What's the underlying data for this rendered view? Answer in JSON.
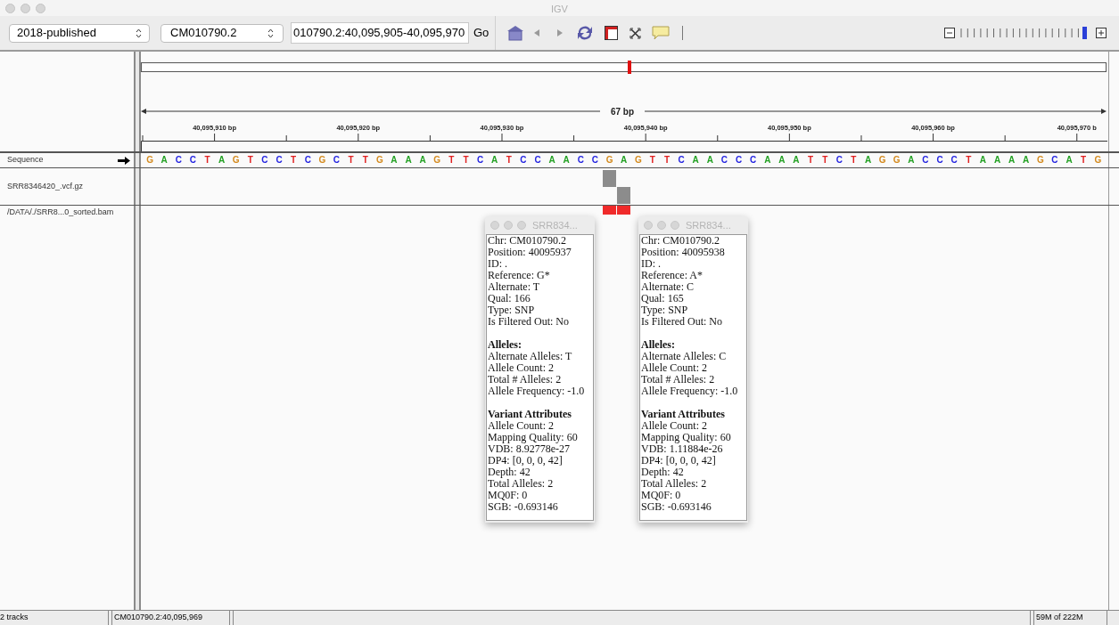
{
  "window": {
    "title": "IGV"
  },
  "toolbar": {
    "genome": "2018-published",
    "chromosome": "CM010790.2",
    "locus": "010790.2:40,095,905-40,095,970",
    "go": "Go",
    "zoom": {
      "level": 0.96
    }
  },
  "ruler": {
    "span": "67 bp",
    "ticks": [
      "40,095,910 bp",
      "40,095,920 bp",
      "40,095,930 bp",
      "40,095,940 bp",
      "40,095,950 bp",
      "40,095,960 bp",
      "40,095,970 b"
    ]
  },
  "tracks": [
    {
      "name": "Sequence",
      "kind": "sequence"
    },
    {
      "name": "SRR8346420_.vcf.gz",
      "kind": "variants"
    },
    {
      "name": "/DATA/./SRR8...0_sorted.bam",
      "kind": "alignments"
    }
  ],
  "bases": [
    {
      "b": "G",
      "color": "#d48a1e"
    },
    {
      "b": "A",
      "color": "#22a022"
    },
    {
      "b": "C",
      "color": "#2424e0"
    },
    {
      "b": "C",
      "color": "#2424e0"
    },
    {
      "b": "T",
      "color": "#e02020"
    },
    {
      "b": "A",
      "color": "#22a022"
    },
    {
      "b": "G",
      "color": "#d48a1e"
    },
    {
      "b": "T",
      "color": "#e02020"
    },
    {
      "b": "C",
      "color": "#2424e0"
    },
    {
      "b": "C",
      "color": "#2424e0"
    },
    {
      "b": "T",
      "color": "#e02020"
    },
    {
      "b": "C",
      "color": "#2424e0"
    },
    {
      "b": "G",
      "color": "#d48a1e"
    },
    {
      "b": "C",
      "color": "#2424e0"
    },
    {
      "b": "T",
      "color": "#e02020"
    },
    {
      "b": "T",
      "color": "#e02020"
    },
    {
      "b": "G",
      "color": "#d48a1e"
    },
    {
      "b": "A",
      "color": "#22a022"
    },
    {
      "b": "A",
      "color": "#22a022"
    },
    {
      "b": "A",
      "color": "#22a022"
    },
    {
      "b": "G",
      "color": "#d48a1e"
    },
    {
      "b": "T",
      "color": "#e02020"
    },
    {
      "b": "T",
      "color": "#e02020"
    },
    {
      "b": "C",
      "color": "#2424e0"
    },
    {
      "b": "A",
      "color": "#22a022"
    },
    {
      "b": "T",
      "color": "#e02020"
    },
    {
      "b": "C",
      "color": "#2424e0"
    },
    {
      "b": "C",
      "color": "#2424e0"
    },
    {
      "b": "A",
      "color": "#22a022"
    },
    {
      "b": "A",
      "color": "#22a022"
    },
    {
      "b": "C",
      "color": "#2424e0"
    },
    {
      "b": "C",
      "color": "#2424e0"
    },
    {
      "b": "G",
      "color": "#d48a1e",
      "kind": "upper"
    },
    {
      "b": "A",
      "color": "#22a022",
      "kind": "lower"
    },
    {
      "b": "G",
      "color": "#d48a1e"
    },
    {
      "b": "T",
      "color": "#e02020"
    },
    {
      "b": "T",
      "color": "#e02020"
    },
    {
      "b": "C",
      "color": "#2424e0"
    },
    {
      "b": "A",
      "color": "#22a022"
    },
    {
      "b": "A",
      "color": "#22a022"
    },
    {
      "b": "C",
      "color": "#2424e0"
    },
    {
      "b": "C",
      "color": "#2424e0"
    },
    {
      "b": "C",
      "color": "#2424e0"
    },
    {
      "b": "A",
      "color": "#22a022"
    },
    {
      "b": "A",
      "color": "#22a022"
    },
    {
      "b": "A",
      "color": "#22a022"
    },
    {
      "b": "T",
      "color": "#e02020"
    },
    {
      "b": "T",
      "color": "#e02020"
    },
    {
      "b": "C",
      "color": "#2424e0"
    },
    {
      "b": "T",
      "color": "#e02020"
    },
    {
      "b": "A",
      "color": "#22a022"
    },
    {
      "b": "G",
      "color": "#d48a1e"
    },
    {
      "b": "G",
      "color": "#d48a1e"
    },
    {
      "b": "A",
      "color": "#22a022"
    },
    {
      "b": "C",
      "color": "#2424e0"
    },
    {
      "b": "C",
      "color": "#2424e0"
    },
    {
      "b": "C",
      "color": "#2424e0"
    },
    {
      "b": "T",
      "color": "#e02020"
    },
    {
      "b": "A",
      "color": "#22a022"
    },
    {
      "b": "A",
      "color": "#22a022"
    },
    {
      "b": "A",
      "color": "#22a022"
    },
    {
      "b": "A",
      "color": "#22a022"
    },
    {
      "b": "G",
      "color": "#d48a1e"
    },
    {
      "b": "C",
      "color": "#2424e0"
    },
    {
      "b": "A",
      "color": "#22a022"
    },
    {
      "b": "T",
      "color": "#e02020"
    },
    {
      "b": "G",
      "color": "#d48a1e"
    }
  ],
  "popups": [
    {
      "title": "SRR834...",
      "sections": [
        {
          "lines": [
            "Chr: CM010790.2",
            "Position: 40095937",
            "ID: .",
            "Reference: G*",
            "Alternate: T",
            "Qual: 166",
            "Type: SNP",
            "Is Filtered Out: No"
          ]
        },
        {
          "heading": "Alleles:",
          "lines": [
            "Alternate Alleles: T",
            "Allele Count: 2",
            "Total # Alleles: 2",
            "Allele Frequency: -1.0"
          ]
        },
        {
          "heading": "Variant Attributes",
          "lines": [
            "Allele Count: 2",
            "Mapping Quality: 60",
            "VDB: 8.92778e-27",
            "DP4: [0, 0, 0, 42]",
            "Depth: 42",
            "Total Alleles: 2",
            "MQ0F: 0",
            "SGB: -0.693146"
          ]
        }
      ]
    },
    {
      "title": "SRR834...",
      "sections": [
        {
          "lines": [
            "Chr: CM010790.2",
            "Position: 40095938",
            "ID: .",
            "Reference: A*",
            "Alternate: C",
            "Qual: 165",
            "Type: SNP",
            "Is Filtered Out: No"
          ]
        },
        {
          "heading": "Alleles:",
          "lines": [
            "Alternate Alleles: C",
            "Allele Count: 2",
            "Total # Alleles: 2",
            "Allele Frequency: -1.0"
          ]
        },
        {
          "heading": "Variant Attributes",
          "lines": [
            "Allele Count: 2",
            "Mapping Quality: 60",
            "VDB: 1.11884e-26",
            "DP4: [0, 0, 0, 42]",
            "Depth: 42",
            "Total Alleles: 2",
            "MQ0F: 0",
            "SGB: -0.693146"
          ]
        }
      ]
    }
  ],
  "status_bar": {
    "tracks": "2 tracks",
    "position": "CM010790.2:40,095,969",
    "memory": "59M of 222M"
  }
}
